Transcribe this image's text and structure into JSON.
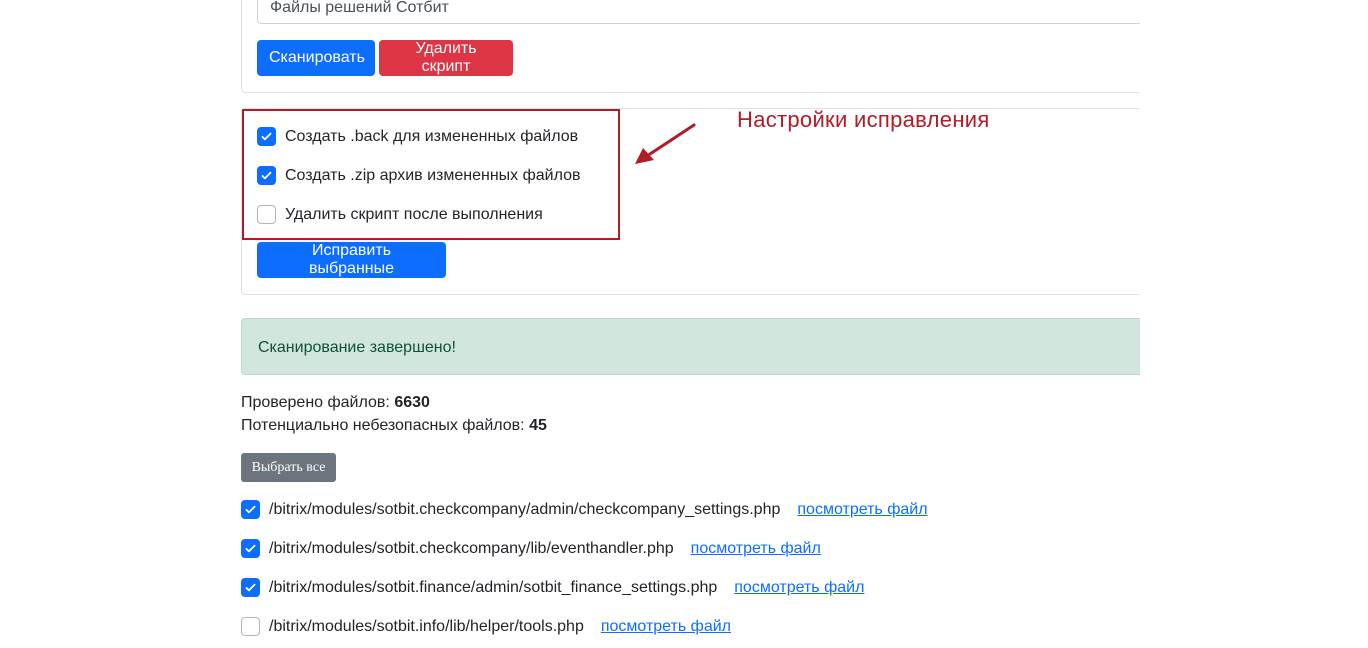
{
  "scan_form": {
    "select_value": "Файлы решений Сотбит",
    "scan_button": "Сканировать",
    "delete_script_button": "Удалить скрипт"
  },
  "fix_options": {
    "items": [
      {
        "label": "Создать .back для измененных файлов",
        "checked": true
      },
      {
        "label": "Создать .zip архив измененных файлов",
        "checked": true
      },
      {
        "label": "Удалить скрипт после выполнения",
        "checked": false
      }
    ],
    "fix_button": "Исправить выбранные",
    "annotation": "Настройки исправления",
    "annotation_color": "#b11c25"
  },
  "alert": {
    "text": "Сканирование завершено!"
  },
  "stats": {
    "checked_label": "Проверено файлов:",
    "checked_value": "6630",
    "unsafe_label": "Потенциально небезопасных файлов:",
    "unsafe_value": "45"
  },
  "select_all_button": "Выбрать все",
  "files": [
    {
      "path": "/bitrix/modules/sotbit.checkcompany/admin/checkcompany_settings.php",
      "link": "посмотреть файл",
      "checked": true
    },
    {
      "path": "/bitrix/modules/sotbit.checkcompany/lib/eventhandler.php",
      "link": "посмотреть файл",
      "checked": true
    },
    {
      "path": "/bitrix/modules/sotbit.finance/admin/sotbit_finance_settings.php",
      "link": "посмотреть файл",
      "checked": true
    },
    {
      "path": "/bitrix/modules/sotbit.info/lib/helper/tools.php",
      "link": "посмотреть файл",
      "checked": false
    }
  ],
  "colors": {
    "primary": "#0d6efd",
    "danger": "#dc3545",
    "secondary": "#6c757d",
    "success_bg": "#d1e7dd"
  }
}
